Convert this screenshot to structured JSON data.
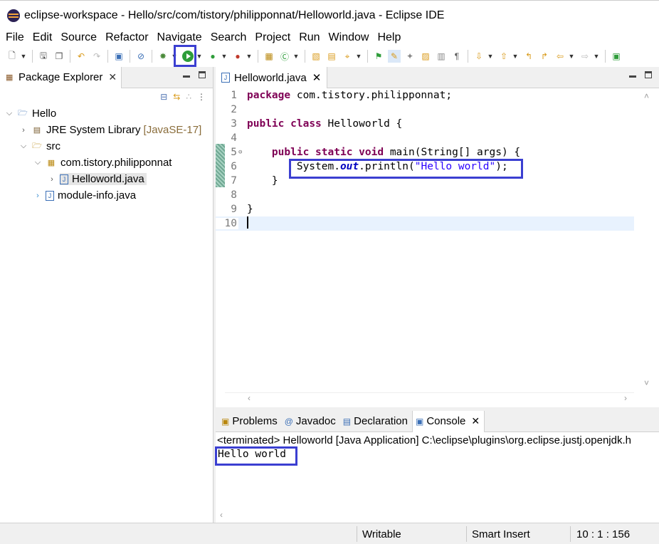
{
  "window": {
    "title": "eclipse-workspace - Hello/src/com/tistory/philipponnat/Helloworld.java - Eclipse IDE"
  },
  "menubar": [
    "File",
    "Edit",
    "Source",
    "Refactor",
    "Navigate",
    "Search",
    "Project",
    "Run",
    "Window",
    "Help"
  ],
  "package_explorer": {
    "tab_label": "Package Explorer",
    "tree": {
      "project": "Hello",
      "jre": "JRE System Library",
      "jre_decoration": "[JavaSE-17]",
      "src": "src",
      "package": "com.tistory.philipponnat",
      "file_selected": "Helloworld.java",
      "module_file": "module-info.java"
    }
  },
  "editor": {
    "tab_label": "Helloworld.java",
    "line_numbers": [
      "1",
      "2",
      "3",
      "4",
      "5",
      "6",
      "7",
      "8",
      "9",
      "10"
    ],
    "code": {
      "l1_kw": "package",
      "l1_rest": " com.tistory.philipponnat;",
      "l3_kw1": "public",
      "l3_kw2": "class",
      "l3_rest": " Helloworld {",
      "l5_indent": "    ",
      "l5_kw1": "public",
      "l5_kw2": "static",
      "l5_kw3": "void",
      "l5_rest": " main(String[] args) {",
      "l6_a": "        System.",
      "l6_field": "out",
      "l6_b": ".println(",
      "l6_str": "\"Hello world\"",
      "l6_c": ");",
      "l7": "    }",
      "l9": "}"
    }
  },
  "bottom_panel": {
    "tabs": [
      "Problems",
      "Javadoc",
      "Declaration",
      "Console"
    ],
    "active_tab": "Console",
    "console_header": "<terminated> Helloworld [Java Application] C:\\eclipse\\plugins\\org.eclipse.justj.openjdk.h",
    "console_output": "Hello world"
  },
  "statusbar": {
    "writable": "Writable",
    "insert_mode": "Smart Insert",
    "position": "10 : 1 : 156"
  },
  "colors": {
    "highlight_box": "#3b3fd1",
    "keyword": "#7f0055",
    "string": "#2a00ff",
    "static_field": "#0000c0",
    "run_green": "#2e9d3a"
  }
}
